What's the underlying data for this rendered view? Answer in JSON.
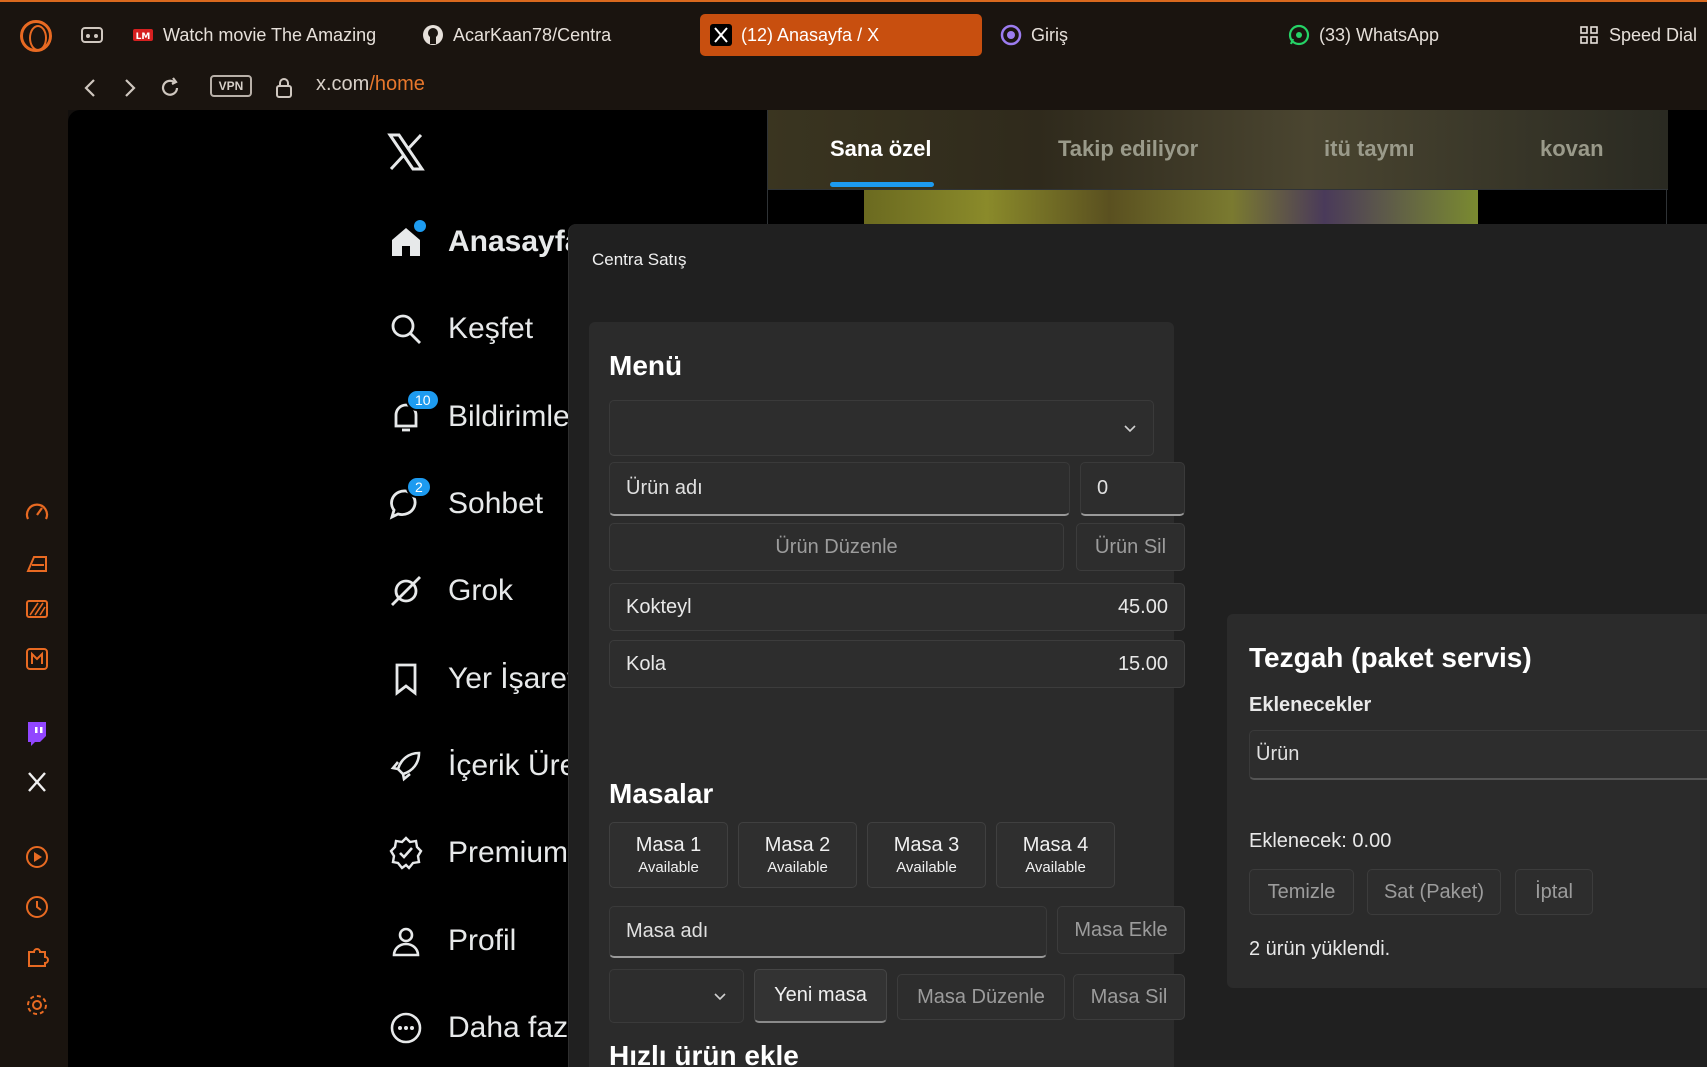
{
  "browser": {
    "tabs": [
      {
        "label": "Watch movie The Amazing",
        "icon": "lm-icon"
      },
      {
        "label": "AcarKaan78/Centra",
        "icon": "github-icon"
      },
      {
        "label": "(12) Anasayfa / X",
        "icon": "x-icon"
      },
      {
        "label": "Giriş",
        "icon": "app-icon"
      },
      {
        "label": "(33) WhatsApp",
        "icon": "whatsapp-icon"
      },
      {
        "label": "Speed Dial",
        "icon": "grid-icon"
      }
    ],
    "vpn_label": "VPN",
    "url_host": "x.com",
    "url_path": "/home",
    "accent": "#e86a22"
  },
  "x": {
    "nav": [
      {
        "label": "Anasayfa"
      },
      {
        "label": "Keşfet"
      },
      {
        "label": "Bildirimler",
        "badge": "10"
      },
      {
        "label": "Sohbet",
        "badge": "2"
      },
      {
        "label": "Grok"
      },
      {
        "label": "Yer İşaretleri"
      },
      {
        "label": "İçerik Üreticileri"
      },
      {
        "label": "Premium"
      },
      {
        "label": "Profil"
      },
      {
        "label": "Daha fazla"
      }
    ],
    "feed_tabs": [
      "Sana özel",
      "Takip ediliyor",
      "itü taymı",
      "kovan"
    ],
    "accent": "#1d9bf0"
  },
  "app": {
    "title": "Centra Satış",
    "menu": {
      "heading": "Menü",
      "dropdown_value": "",
      "name_placeholder": "Ürün adı",
      "price_value": "0",
      "edit_btn": "Ürün Düzenle",
      "delete_btn": "Ürün Sil",
      "items": [
        {
          "name": "Kokteyl",
          "price": "45.00"
        },
        {
          "name": "Kola",
          "price": "15.00"
        }
      ]
    },
    "tables": {
      "heading": "Masalar",
      "items": [
        {
          "name": "Masa 1",
          "status": "Available"
        },
        {
          "name": "Masa 2",
          "status": "Available"
        },
        {
          "name": "Masa 3",
          "status": "Available"
        },
        {
          "name": "Masa 4",
          "status": "Available"
        }
      ],
      "name_placeholder": "Masa adı",
      "add_btn": "Masa Ekle",
      "new_btn": "Yeni masa",
      "edit_btn": "Masa Düzenle",
      "delete_btn": "Masa Sil"
    },
    "quick": {
      "heading": "Hızlı ürün ekle"
    },
    "counter": {
      "heading": "Tezgah (paket servis)",
      "sub": "Eklenecekler",
      "column": "Ürün",
      "total": "Eklenecek: 0.00",
      "clear_btn": "Temizle",
      "sell_btn": "Sat (Paket)",
      "cancel_btn": "İptal",
      "status": "2 ürün yüklendi."
    }
  }
}
